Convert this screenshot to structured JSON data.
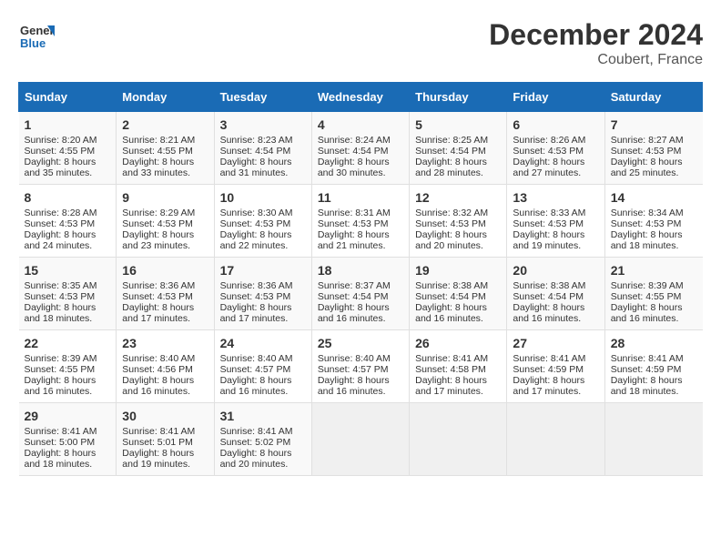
{
  "header": {
    "logo_line1": "General",
    "logo_line2": "Blue",
    "title": "December 2024",
    "subtitle": "Coubert, France"
  },
  "columns": [
    "Sunday",
    "Monday",
    "Tuesday",
    "Wednesday",
    "Thursday",
    "Friday",
    "Saturday"
  ],
  "weeks": [
    [
      {
        "day": "1",
        "lines": [
          "Sunrise: 8:20 AM",
          "Sunset: 4:55 PM",
          "Daylight: 8 hours",
          "and 35 minutes."
        ]
      },
      {
        "day": "2",
        "lines": [
          "Sunrise: 8:21 AM",
          "Sunset: 4:55 PM",
          "Daylight: 8 hours",
          "and 33 minutes."
        ]
      },
      {
        "day": "3",
        "lines": [
          "Sunrise: 8:23 AM",
          "Sunset: 4:54 PM",
          "Daylight: 8 hours",
          "and 31 minutes."
        ]
      },
      {
        "day": "4",
        "lines": [
          "Sunrise: 8:24 AM",
          "Sunset: 4:54 PM",
          "Daylight: 8 hours",
          "and 30 minutes."
        ]
      },
      {
        "day": "5",
        "lines": [
          "Sunrise: 8:25 AM",
          "Sunset: 4:54 PM",
          "Daylight: 8 hours",
          "and 28 minutes."
        ]
      },
      {
        "day": "6",
        "lines": [
          "Sunrise: 8:26 AM",
          "Sunset: 4:53 PM",
          "Daylight: 8 hours",
          "and 27 minutes."
        ]
      },
      {
        "day": "7",
        "lines": [
          "Sunrise: 8:27 AM",
          "Sunset: 4:53 PM",
          "Daylight: 8 hours",
          "and 25 minutes."
        ]
      }
    ],
    [
      {
        "day": "8",
        "lines": [
          "Sunrise: 8:28 AM",
          "Sunset: 4:53 PM",
          "Daylight: 8 hours",
          "and 24 minutes."
        ]
      },
      {
        "day": "9",
        "lines": [
          "Sunrise: 8:29 AM",
          "Sunset: 4:53 PM",
          "Daylight: 8 hours",
          "and 23 minutes."
        ]
      },
      {
        "day": "10",
        "lines": [
          "Sunrise: 8:30 AM",
          "Sunset: 4:53 PM",
          "Daylight: 8 hours",
          "and 22 minutes."
        ]
      },
      {
        "day": "11",
        "lines": [
          "Sunrise: 8:31 AM",
          "Sunset: 4:53 PM",
          "Daylight: 8 hours",
          "and 21 minutes."
        ]
      },
      {
        "day": "12",
        "lines": [
          "Sunrise: 8:32 AM",
          "Sunset: 4:53 PM",
          "Daylight: 8 hours",
          "and 20 minutes."
        ]
      },
      {
        "day": "13",
        "lines": [
          "Sunrise: 8:33 AM",
          "Sunset: 4:53 PM",
          "Daylight: 8 hours",
          "and 19 minutes."
        ]
      },
      {
        "day": "14",
        "lines": [
          "Sunrise: 8:34 AM",
          "Sunset: 4:53 PM",
          "Daylight: 8 hours",
          "and 18 minutes."
        ]
      }
    ],
    [
      {
        "day": "15",
        "lines": [
          "Sunrise: 8:35 AM",
          "Sunset: 4:53 PM",
          "Daylight: 8 hours",
          "and 18 minutes."
        ]
      },
      {
        "day": "16",
        "lines": [
          "Sunrise: 8:36 AM",
          "Sunset: 4:53 PM",
          "Daylight: 8 hours",
          "and 17 minutes."
        ]
      },
      {
        "day": "17",
        "lines": [
          "Sunrise: 8:36 AM",
          "Sunset: 4:53 PM",
          "Daylight: 8 hours",
          "and 17 minutes."
        ]
      },
      {
        "day": "18",
        "lines": [
          "Sunrise: 8:37 AM",
          "Sunset: 4:54 PM",
          "Daylight: 8 hours",
          "and 16 minutes."
        ]
      },
      {
        "day": "19",
        "lines": [
          "Sunrise: 8:38 AM",
          "Sunset: 4:54 PM",
          "Daylight: 8 hours",
          "and 16 minutes."
        ]
      },
      {
        "day": "20",
        "lines": [
          "Sunrise: 8:38 AM",
          "Sunset: 4:54 PM",
          "Daylight: 8 hours",
          "and 16 minutes."
        ]
      },
      {
        "day": "21",
        "lines": [
          "Sunrise: 8:39 AM",
          "Sunset: 4:55 PM",
          "Daylight: 8 hours",
          "and 16 minutes."
        ]
      }
    ],
    [
      {
        "day": "22",
        "lines": [
          "Sunrise: 8:39 AM",
          "Sunset: 4:55 PM",
          "Daylight: 8 hours",
          "and 16 minutes."
        ]
      },
      {
        "day": "23",
        "lines": [
          "Sunrise: 8:40 AM",
          "Sunset: 4:56 PM",
          "Daylight: 8 hours",
          "and 16 minutes."
        ]
      },
      {
        "day": "24",
        "lines": [
          "Sunrise: 8:40 AM",
          "Sunset: 4:57 PM",
          "Daylight: 8 hours",
          "and 16 minutes."
        ]
      },
      {
        "day": "25",
        "lines": [
          "Sunrise: 8:40 AM",
          "Sunset: 4:57 PM",
          "Daylight: 8 hours",
          "and 16 minutes."
        ]
      },
      {
        "day": "26",
        "lines": [
          "Sunrise: 8:41 AM",
          "Sunset: 4:58 PM",
          "Daylight: 8 hours",
          "and 17 minutes."
        ]
      },
      {
        "day": "27",
        "lines": [
          "Sunrise: 8:41 AM",
          "Sunset: 4:59 PM",
          "Daylight: 8 hours",
          "and 17 minutes."
        ]
      },
      {
        "day": "28",
        "lines": [
          "Sunrise: 8:41 AM",
          "Sunset: 4:59 PM",
          "Daylight: 8 hours",
          "and 18 minutes."
        ]
      }
    ],
    [
      {
        "day": "29",
        "lines": [
          "Sunrise: 8:41 AM",
          "Sunset: 5:00 PM",
          "Daylight: 8 hours",
          "and 18 minutes."
        ]
      },
      {
        "day": "30",
        "lines": [
          "Sunrise: 8:41 AM",
          "Sunset: 5:01 PM",
          "Daylight: 8 hours",
          "and 19 minutes."
        ]
      },
      {
        "day": "31",
        "lines": [
          "Sunrise: 8:41 AM",
          "Sunset: 5:02 PM",
          "Daylight: 8 hours",
          "and 20 minutes."
        ]
      },
      null,
      null,
      null,
      null
    ]
  ]
}
